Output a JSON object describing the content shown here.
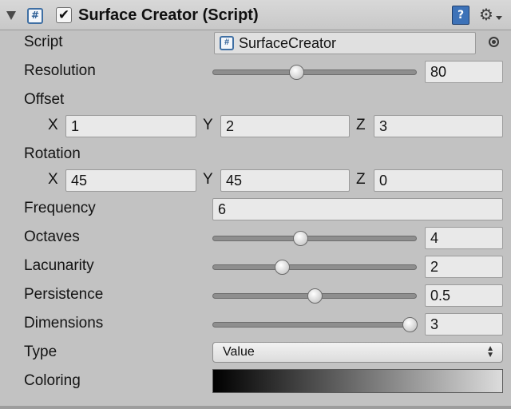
{
  "header": {
    "title": "Surface Creator (Script)",
    "enabled": true,
    "script_icon_glyph": "#",
    "check_glyph": "✔",
    "help_glyph": "?",
    "gear_glyph": "⚙",
    "icons": [
      "foldout-arrow-icon",
      "script-icon",
      "enabled-checkbox",
      "help-book-icon",
      "gear-icon"
    ]
  },
  "script": {
    "label": "Script",
    "value": "SurfaceCreator",
    "icon_glyph": "#"
  },
  "resolution": {
    "label": "Resolution",
    "value": "80",
    "slider_fraction": 0.41
  },
  "offset": {
    "label": "Offset",
    "x_label": "X",
    "x": "1",
    "y_label": "Y",
    "y": "2",
    "z_label": "Z",
    "z": "3"
  },
  "rotation": {
    "label": "Rotation",
    "x_label": "X",
    "x": "45",
    "y_label": "Y",
    "y": "45",
    "z_label": "Z",
    "z": "0"
  },
  "frequency": {
    "label": "Frequency",
    "value": "6"
  },
  "octaves": {
    "label": "Octaves",
    "value": "4",
    "slider_fraction": 0.43
  },
  "lacunarity": {
    "label": "Lacunarity",
    "value": "2",
    "slider_fraction": 0.34
  },
  "persistence": {
    "label": "Persistence",
    "value": "0.5",
    "slider_fraction": 0.5
  },
  "dimensions": {
    "label": "Dimensions",
    "value": "3",
    "slider_fraction": 0.97
  },
  "type": {
    "label": "Type",
    "value": "Value",
    "arrow_glyph": "▲▼"
  },
  "coloring": {
    "label": "Coloring",
    "gradient_start": "#000000",
    "gradient_end": "#dcdcdc"
  },
  "colors": {
    "panel": "#c2c2c2",
    "field": "#e9e9e9",
    "accent": "#3d72b8"
  }
}
